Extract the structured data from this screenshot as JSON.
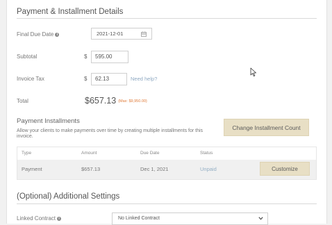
{
  "payment_section": {
    "title": "Payment & Installment Details",
    "final_due_date_label": "Final Due Date",
    "final_due_date_value": "2021-12-01",
    "subtotal_label": "Subtotal",
    "currency": "$",
    "subtotal_value": "595.00",
    "tax_label": "Invoice Tax",
    "tax_value": "62.13",
    "help_link": "Need help?",
    "total_label": "Total",
    "total_value": "$657.13",
    "total_max": "(Max: $9,950.00)"
  },
  "installments": {
    "title": "Payment Installments",
    "description": "Allow your clients to make payments over time by creating multiple installments for this invoice.",
    "change_button": "Change Installment Count",
    "columns": [
      "Type",
      "Amount",
      "Due Date",
      "Status"
    ],
    "rows": [
      {
        "type": "Payment",
        "amount": "$657.13",
        "due_date": "Dec 1, 2021",
        "status": "Unpaid",
        "action": "Customize"
      }
    ]
  },
  "additional": {
    "title": "(Optional) Additional Settings",
    "linked_contract_label": "Linked Contract",
    "linked_contract_value": "No Linked Contract"
  },
  "colors": {
    "accent_button": "#e8dfc5",
    "max_text": "#e07b39",
    "link": "#8fa9c2"
  }
}
